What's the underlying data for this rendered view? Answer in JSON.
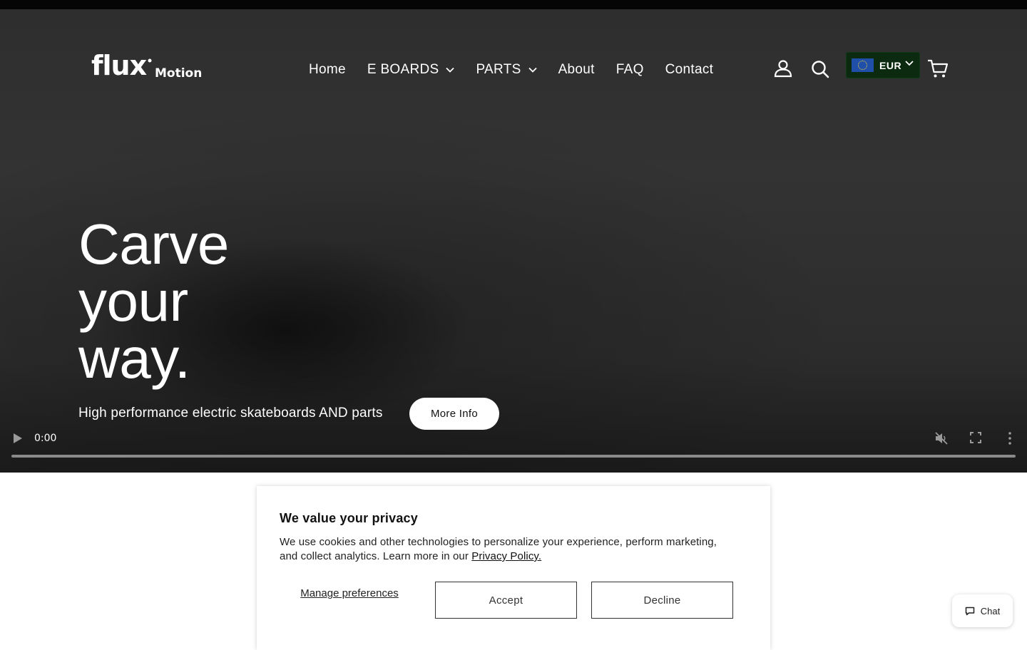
{
  "brand": {
    "name": "flux",
    "sub": "Motion"
  },
  "nav": {
    "home": "Home",
    "eboards": "E BOARDS",
    "parts": "PARTS",
    "about": "About",
    "faq": "FAQ",
    "contact": "Contact"
  },
  "header_icons": {
    "account": "account-icon",
    "search": "search-icon",
    "cart": "cart-icon"
  },
  "currency": {
    "code": "EUR",
    "flag": "eu-flag"
  },
  "hero": {
    "headline_lines": [
      "Carve",
      "your",
      "way."
    ],
    "subline": "High performance electric skateboards AND parts",
    "cta": "More Info"
  },
  "video": {
    "time": "0:00",
    "muted": true,
    "progress": 0
  },
  "cookie": {
    "title": "We value your privacy",
    "text": "We use cookies and other technologies to personalize your experience, perform marketing, and collect analytics. Learn more in our",
    "link": "Privacy Policy.",
    "manage": "Manage preferences",
    "accept": "Accept",
    "decline": "Decline"
  },
  "chat": {
    "label": "Chat"
  },
  "colors": {
    "hero_bg": "#2f2f2f",
    "currency_bg": "#0c2a10",
    "eu_blue": "#1f4fa8"
  }
}
